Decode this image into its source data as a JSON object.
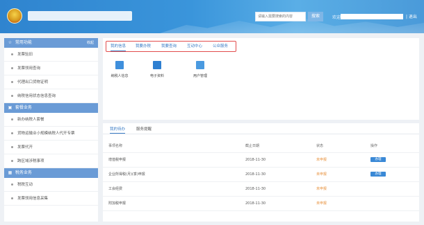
{
  "header": {
    "search_placeholder": "请输入需要搜索的内容",
    "search_button": "搜索",
    "welcome": "欢迎",
    "exit": "| 退出"
  },
  "sidebar": {
    "sections": [
      {
        "title": "常用功能",
        "icon": "star-icon",
        "collapse": "收起",
        "items": [
          "发票验旧",
          "发票领用查询",
          "代理出口货物证明",
          "纳税信用状态信息查询"
        ]
      },
      {
        "title": "套餐业务",
        "icon": "package-icon",
        "items": [
          "新办纳税人套餐",
          "货物运输业小规模纳税人代开专票",
          "发票代开",
          "跨区域涉税事项"
        ]
      },
      {
        "title": "税务业务",
        "icon": "grid-icon",
        "items": [
          "税税互动",
          "发票领用信息采集"
        ]
      }
    ]
  },
  "top_tabs": [
    "我的信息",
    "我要办税",
    "我要查询",
    "互动中心",
    "公众服务"
  ],
  "services": [
    {
      "label": "纳税人信息",
      "icon": "taxpayer-info-icon",
      "color": "#3f8fdc"
    },
    {
      "label": "电子资料",
      "icon": "electronic-data-icon",
      "color": "#2e7fd1"
    },
    {
      "label": "用户管理",
      "icon": "user-management-icon",
      "color": "#4a9ae0"
    }
  ],
  "sub_tabs": [
    "我的待办",
    "服务提醒"
  ],
  "table": {
    "headers": [
      "事项名称",
      "截止日期",
      "状态",
      "操作"
    ],
    "rows": [
      {
        "name": "增值税申报",
        "date": "2018-11-30",
        "status": "未申报",
        "action": "办理"
      },
      {
        "name": "企业所得税(月)(季)申报",
        "date": "2018-11-30",
        "status": "未申报",
        "action": "办理"
      },
      {
        "name": "工会经费",
        "date": "2018-11-30",
        "status": "未申报",
        "action": ""
      },
      {
        "name": "附加税申报",
        "date": "2018-11-30",
        "status": "未申报",
        "action": ""
      }
    ]
  },
  "colors": {
    "accent": "#3a7cc5",
    "header": "#3a95db",
    "sidebar_head": "#6a9bd6",
    "status": "#e8913c",
    "highlight_border": "#e24c4c"
  }
}
